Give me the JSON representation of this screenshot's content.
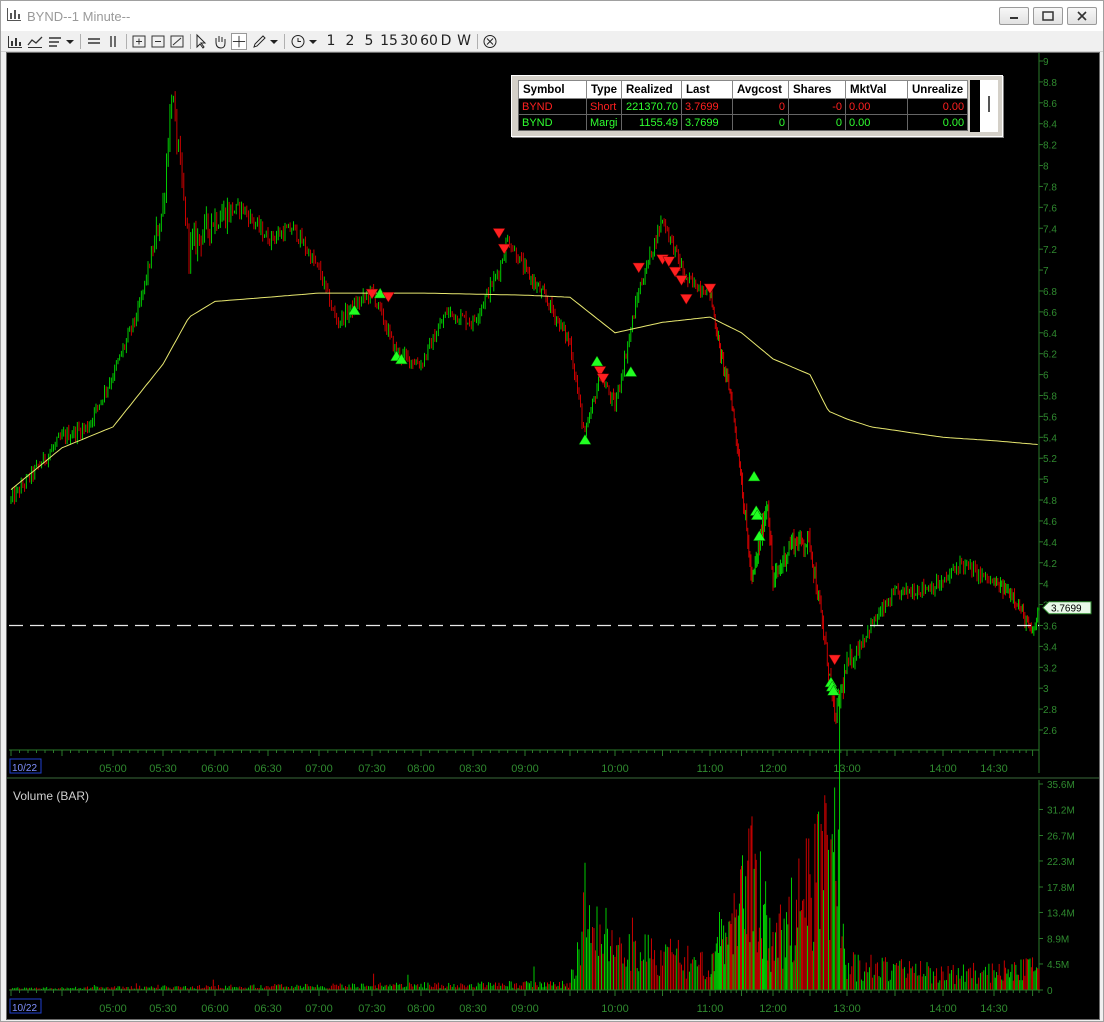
{
  "window": {
    "title": "BYND--1 Minute--"
  },
  "toolbar": {
    "timeframes": [
      "1",
      "2",
      "5",
      "15",
      "30",
      "60",
      "D",
      "W"
    ]
  },
  "positions": {
    "headers": [
      "Symbol",
      "Type",
      "Realized",
      "Last",
      "Avgcost",
      "Shares",
      "MktVal",
      "Unrealize"
    ],
    "rows": [
      {
        "symbol": "BYND",
        "type": "Short",
        "realized": "221370.70",
        "last": "3.7699",
        "avgcost": "0",
        "shares": "-0",
        "mktval": "0.00",
        "unrealized": "0.00"
      },
      {
        "symbol": "BYND",
        "type": "Margi",
        "realized": "1155.49",
        "last": "3.7699",
        "avgcost": "0",
        "shares": "0",
        "mktval": "0.00",
        "unrealized": "0.00"
      }
    ]
  },
  "price_axis": {
    "labels": [
      "9",
      "8.8",
      "8.6",
      "8.4",
      "8.2",
      "8",
      "7.8",
      "7.6",
      "7.4",
      "7.2",
      "7",
      "6.8",
      "6.6",
      "6.4",
      "6.2",
      "6",
      "5.8",
      "5.6",
      "5.4",
      "5.2",
      "5",
      "4.8",
      "4.6",
      "4.4",
      "4.2",
      "4",
      "3.8",
      "3.6",
      "3.4",
      "3.2",
      "3",
      "2.8",
      "2.6"
    ],
    "last_price_tag": "3.7699"
  },
  "time_axis": {
    "date_label": "10/22",
    "labels": [
      "05:00",
      "05:30",
      "06:00",
      "06:30",
      "07:00",
      "07:30",
      "08:00",
      "08:30",
      "09:00",
      "10:00",
      "11:00",
      "12:00",
      "13:00",
      "14:00",
      "14:30"
    ]
  },
  "volume_panel": {
    "title": "Volume (BAR)",
    "axis_labels": [
      "35.6M",
      "31.2M",
      "26.7M",
      "22.3M",
      "17.8M",
      "13.4M",
      "8.9M",
      "4.5M",
      "0"
    ],
    "date_label": "10/22"
  },
  "colors": {
    "up": "#00e000",
    "down": "#e00000",
    "vwap": "#e8e870",
    "background": "#000000",
    "axis": "#2a7a2a"
  },
  "chart_data": {
    "type": "candlestick",
    "symbol": "BYND",
    "interval": "1 Minute",
    "ylim": [
      2.6,
      9.0
    ],
    "last_price": 3.7699,
    "price_path": [
      [
        "04:00",
        4.8
      ],
      [
        "04:30",
        5.4
      ],
      [
        "04:45",
        5.5
      ],
      [
        "05:00",
        6.0
      ],
      [
        "05:15",
        6.6
      ],
      [
        "05:30",
        7.6
      ],
      [
        "05:35",
        8.7
      ],
      [
        "05:45",
        7.2
      ],
      [
        "06:00",
        7.5
      ],
      [
        "06:15",
        7.6
      ],
      [
        "06:30",
        7.3
      ],
      [
        "06:45",
        7.4
      ],
      [
        "07:00",
        7.0
      ],
      [
        "07:10",
        6.5
      ],
      [
        "07:30",
        6.8
      ],
      [
        "07:45",
        6.2
      ],
      [
        "08:00",
        6.1
      ],
      [
        "08:15",
        6.6
      ],
      [
        "08:30",
        6.5
      ],
      [
        "08:45",
        7.0
      ],
      [
        "08:50",
        7.3
      ],
      [
        "09:00",
        7.0
      ],
      [
        "09:15",
        6.7
      ],
      [
        "09:30",
        6.3
      ],
      [
        "09:40",
        5.4
      ],
      [
        "09:50",
        6.0
      ],
      [
        "10:00",
        5.7
      ],
      [
        "10:15",
        6.8
      ],
      [
        "10:30",
        7.5
      ],
      [
        "10:45",
        6.9
      ],
      [
        "11:00",
        6.8
      ],
      [
        "11:10",
        6.2
      ],
      [
        "11:20",
        5.8
      ],
      [
        "11:30",
        5.0
      ],
      [
        "11:40",
        4.0
      ],
      [
        "11:55",
        4.8
      ],
      [
        "12:00",
        4.0
      ],
      [
        "12:15",
        4.4
      ],
      [
        "12:30",
        4.4
      ],
      [
        "12:45",
        3.2
      ],
      [
        "12:50",
        2.7
      ],
      [
        "13:00",
        3.2
      ],
      [
        "13:15",
        3.6
      ],
      [
        "13:30",
        3.9
      ],
      [
        "14:00",
        4.0
      ],
      [
        "14:10",
        4.2
      ],
      [
        "14:30",
        4.0
      ],
      [
        "14:45",
        3.9
      ],
      [
        "15:00",
        3.5
      ],
      [
        "15:05",
        3.77
      ]
    ],
    "vwap_path": [
      [
        "04:00",
        4.9
      ],
      [
        "04:30",
        5.3
      ],
      [
        "05:00",
        5.5
      ],
      [
        "05:15",
        5.8
      ],
      [
        "05:30",
        6.1
      ],
      [
        "05:45",
        6.55
      ],
      [
        "06:00",
        6.7
      ],
      [
        "07:00",
        6.78
      ],
      [
        "08:00",
        6.78
      ],
      [
        "09:00",
        6.76
      ],
      [
        "09:30",
        6.74
      ],
      [
        "10:00",
        6.4
      ],
      [
        "10:30",
        6.5
      ],
      [
        "11:00",
        6.55
      ],
      [
        "11:30",
        6.4
      ],
      [
        "12:00",
        6.15
      ],
      [
        "12:30",
        6.0
      ],
      [
        "12:45",
        5.65
      ],
      [
        "13:15",
        5.5
      ],
      [
        "14:00",
        5.4
      ],
      [
        "15:05",
        5.33
      ]
    ],
    "reference_line": 3.6,
    "buy_markers": [
      [
        "07:20",
        6.62
      ],
      [
        "07:35",
        6.78
      ],
      [
        "07:45",
        6.18
      ],
      [
        "07:48",
        6.15
      ],
      [
        "09:40",
        5.38
      ],
      [
        "09:48",
        6.13
      ],
      [
        "10:10",
        6.03
      ],
      [
        "11:42",
        5.03
      ],
      [
        "11:44",
        4.7
      ],
      [
        "11:45",
        4.66
      ],
      [
        "11:47",
        4.46
      ],
      [
        "12:47",
        3.06
      ],
      [
        "12:48",
        3.02
      ],
      [
        "12:49",
        2.98
      ]
    ],
    "sell_markers": [
      [
        "07:30",
        6.77
      ],
      [
        "07:40",
        6.74
      ],
      [
        "08:45",
        7.35
      ],
      [
        "08:48",
        7.2
      ],
      [
        "09:50",
        6.03
      ],
      [
        "09:52",
        5.96
      ],
      [
        "10:15",
        7.02
      ],
      [
        "10:30",
        7.1
      ],
      [
        "10:34",
        7.08
      ],
      [
        "10:38",
        6.98
      ],
      [
        "10:42",
        6.9
      ],
      [
        "10:45",
        6.72
      ],
      [
        "11:00",
        6.82
      ],
      [
        "12:50",
        3.27
      ]
    ],
    "volume": {
      "unit": "shares",
      "ylim": [
        0,
        35600000
      ],
      "profile": [
        [
          "04:00",
          0.4
        ],
        [
          "09:30",
          1.5
        ],
        [
          "09:40",
          22.0
        ],
        [
          "10:00",
          9.0
        ],
        [
          "10:30",
          8.0
        ],
        [
          "11:00",
          7.0
        ],
        [
          "11:40",
          30.0
        ],
        [
          "12:00",
          10.0
        ],
        [
          "12:50",
          35.0
        ],
        [
          "13:00",
          6.0
        ],
        [
          "14:00",
          4.0
        ],
        [
          "15:05",
          5.0
        ]
      ]
    }
  }
}
